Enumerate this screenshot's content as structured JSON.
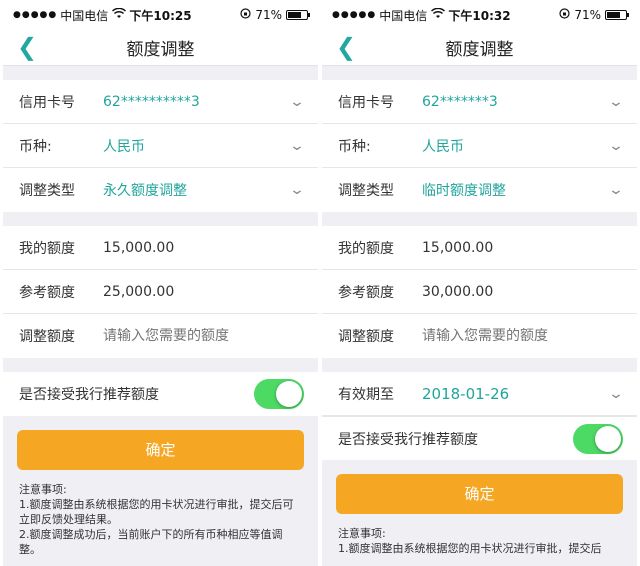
{
  "status_bar": {
    "signal": "●●●●●",
    "carrier": "中国电信",
    "wifi_icon": "wifi-icon",
    "battery_percent": "71%"
  },
  "screens": [
    {
      "time": "下午10:25",
      "nav_title": "额度调整",
      "card_label": "信用卡号",
      "card_value": "62**********3",
      "currency_label": "币种:",
      "currency_value": "人民币",
      "type_label": "调整类型",
      "type_value": "永久额度调整",
      "my_limit_label": "我的额度",
      "my_limit_value": "15,000.00",
      "ref_limit_label": "参考额度",
      "ref_limit_value": "25,000.00",
      "adjust_label": "调整额度",
      "adjust_placeholder": "请输入您需要的额度",
      "accept_label": "是否接受我行推荐额度",
      "confirm_label": "确定",
      "notes": [
        "注意事项:",
        "1.额度调整由系统根据您的用卡状况进行审批，提交后可立即反馈处理结果。",
        "2.额度调整成功后，当前账户下的所有币种相应等值调整。"
      ]
    },
    {
      "time": "下午10:32",
      "nav_title": "额度调整",
      "card_label": "信用卡号",
      "card_value": "62*******3",
      "currency_label": "币种:",
      "currency_value": "人民币",
      "type_label": "调整类型",
      "type_value": "临时额度调整",
      "my_limit_label": "我的额度",
      "my_limit_value": "15,000.00",
      "ref_limit_label": "参考额度",
      "ref_limit_value": "30,000.00",
      "adjust_label": "调整额度",
      "adjust_placeholder": "请输入您需要的额度",
      "expiry_label": "有效期至",
      "expiry_value": "2018-01-26",
      "accept_label": "是否接受我行推荐额度",
      "confirm_label": "确定",
      "notes": [
        "注意事项:",
        "1.额度调整由系统根据您的用卡状况进行审批，提交后"
      ]
    }
  ],
  "colors": {
    "accent": "#20a59c",
    "confirm_button": "#f5a623",
    "switch_on": "#4cd964",
    "background": "#efeff4"
  }
}
